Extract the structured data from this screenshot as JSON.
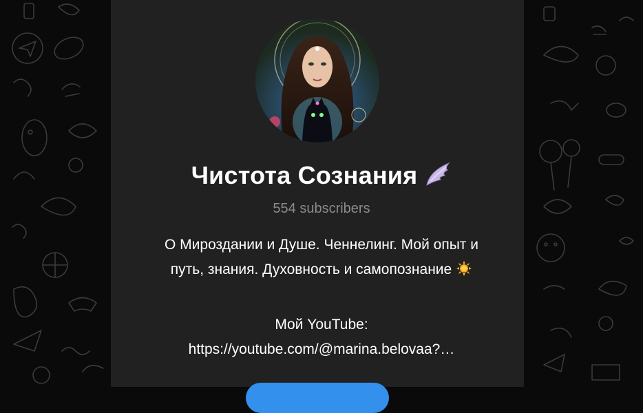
{
  "channel": {
    "title": "Чистота Сознания",
    "title_emoji_icon": "angel-wing-icon",
    "subscribers": "554 subscribers",
    "description_line1": "О Мироздании и Душе. Ченнелинг. Мой опыт и",
    "description_line2": "путь, знания. Духовность и самопознание",
    "description_emoji_icon": "sun-emoji-icon",
    "youtube_label": "Мой YouTube:",
    "youtube_link": "https://youtube.com/@marina.belovaa?…"
  },
  "colors": {
    "page_background": "#0a0a0a",
    "card_background": "#212121",
    "title": "#ffffff",
    "subscribers": "#8b8b8b",
    "button": "#3390ec"
  }
}
